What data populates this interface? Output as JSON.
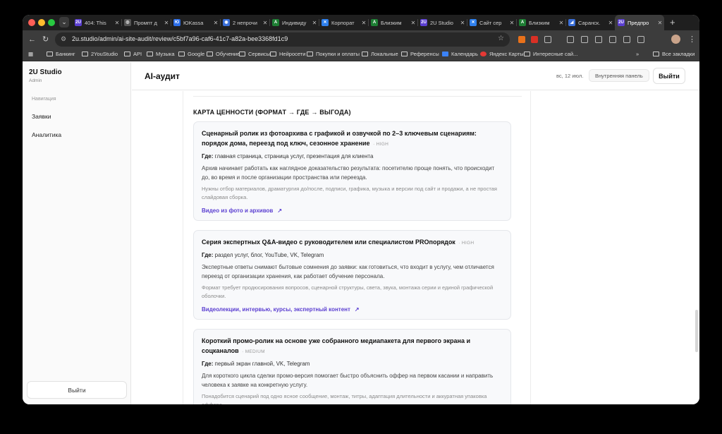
{
  "browser": {
    "tabs": [
      {
        "favicon": "2U",
        "favicon_color": "#5b3fd1",
        "title": "404: This"
      },
      {
        "favicon": "◎",
        "favicon_color": "#555555",
        "title": "Промпт д"
      },
      {
        "favicon": "Ю",
        "favicon_color": "#2b6de8",
        "title": "ЮKassa"
      },
      {
        "favicon": "◉",
        "favicon_color": "#3a6fd8",
        "title": "2 непрочи"
      },
      {
        "favicon": "A",
        "favicon_color": "#1e7e34",
        "title": "Индивиду"
      },
      {
        "favicon": "✕",
        "favicon_color": "#2f80ed",
        "title": "Корпорат"
      },
      {
        "favicon": "A",
        "favicon_color": "#1e7e34",
        "title": "Близким"
      },
      {
        "favicon": "2U",
        "favicon_color": "#5b3fd1",
        "title": "2U Studio"
      },
      {
        "favicon": "✕",
        "favicon_color": "#2f80ed",
        "title": "Сайт сер"
      },
      {
        "favicon": "A",
        "favicon_color": "#1e7e34",
        "title": "Близким"
      },
      {
        "favicon": "◢",
        "favicon_color": "#3a6fd8",
        "title": "Саранск."
      },
      {
        "favicon": "2U",
        "favicon_color": "#5b3fd1",
        "title": "Предпро",
        "active": true
      }
    ],
    "new_tab": "+",
    "tab_menu": "⌄",
    "url": "2u.studio/admin/ai-site-audit/review/c5bf7a96-caf6-41c7-a82a-bee3368fd1c9",
    "bookmarks": [
      {
        "label": "Банкинг",
        "type": "folder"
      },
      {
        "label": "2YouStudio",
        "type": "folder"
      },
      {
        "label": "API",
        "type": "folder"
      },
      {
        "label": "Музыка",
        "type": "folder"
      },
      {
        "label": "Google",
        "type": "folder"
      },
      {
        "label": "Обучение",
        "type": "folder"
      },
      {
        "label": "Сервисы",
        "type": "folder"
      },
      {
        "label": "Нейросети",
        "type": "folder"
      },
      {
        "label": "Покупки и оплаты",
        "type": "folder"
      },
      {
        "label": "Локальные",
        "type": "folder"
      },
      {
        "label": "Референсы",
        "type": "folder"
      },
      {
        "label": "Календарь",
        "type": "calendar"
      },
      {
        "label": "Яндекс Карты",
        "type": "map"
      },
      {
        "label": "Интересные сай...",
        "type": "folder"
      }
    ],
    "bookmarks_more": "»",
    "all_bookmarks": "Все закладки"
  },
  "sidebar": {
    "brand": "2U Studio",
    "role": "Admin",
    "nav_label": "Навигация",
    "items": [
      "Заявки",
      "Аналитика"
    ],
    "logout": "Выйти"
  },
  "header": {
    "title": "AI-аудит",
    "date": "вс, 12 июл.",
    "badge": "Внутренняя панель",
    "logout": "Выйти"
  },
  "content": {
    "section_title": "КАРТА ЦЕННОСТИ (ФОРМАТ → ГДЕ → ВЫГОДА)",
    "cards": [
      {
        "title": "Сценарный ролик из фотоархива с графикой и озвучкой по 2–3 ключевым сценариям: порядок дома, переезд под ключ, сезонное хранение",
        "priority": "· HIGH",
        "where_label": "Где:",
        "where": "главная страница, страница услуг, презентация для клиента",
        "description": "Архив начинает работать как наглядное доказательство результата: посетителю проще понять, что происходит до, во время и после организации пространства или переезда.",
        "note": "Нужны отбор материалов, драматургия до/после, подписи, графика, музыка и версии под сайт и продажи, а не простая слайдовая сборка.",
        "link": "Видео из фото и архивов",
        "link_arrow": "↗"
      },
      {
        "title": "Серия экспертных Q&A-видео с руководителем или специалистом PROпорядок",
        "priority": "· HIGH",
        "where_label": "Где:",
        "where": "раздел услуг, блог, YouTube, VK, Telegram",
        "description": "Экспертные ответы снимают бытовые сомнения до заявки: как готовиться, что входит в услугу, чем отличается переезд от организации хранения, как работает обучение персонала.",
        "note": "Формат требует продюсирования вопросов, сценарной структуры, света, звука, монтажа серии и единой графической оболочки.",
        "link": "Видеолекции, интервью, курсы, экспертный контент",
        "link_arrow": "↗"
      },
      {
        "title": "Короткий промо-ролик на основе уже собранного медиапакета для первого экрана и соцканалов",
        "priority": "· MEDIUM",
        "where_label": "Где:",
        "where": "первый экран главной, VK, Telegram",
        "description": "Для короткого цикла сделки промо-версия помогает быстро объяснить оффер на первом касании и направить человека к заявке на конкретную услугу.",
        "note": "Понадобится сценарий под одно ясное сообщение, монтаж, титры, адаптация длительности и аккуратная упаковка оффера.",
        "link": "",
        "link_arrow": ""
      }
    ]
  }
}
